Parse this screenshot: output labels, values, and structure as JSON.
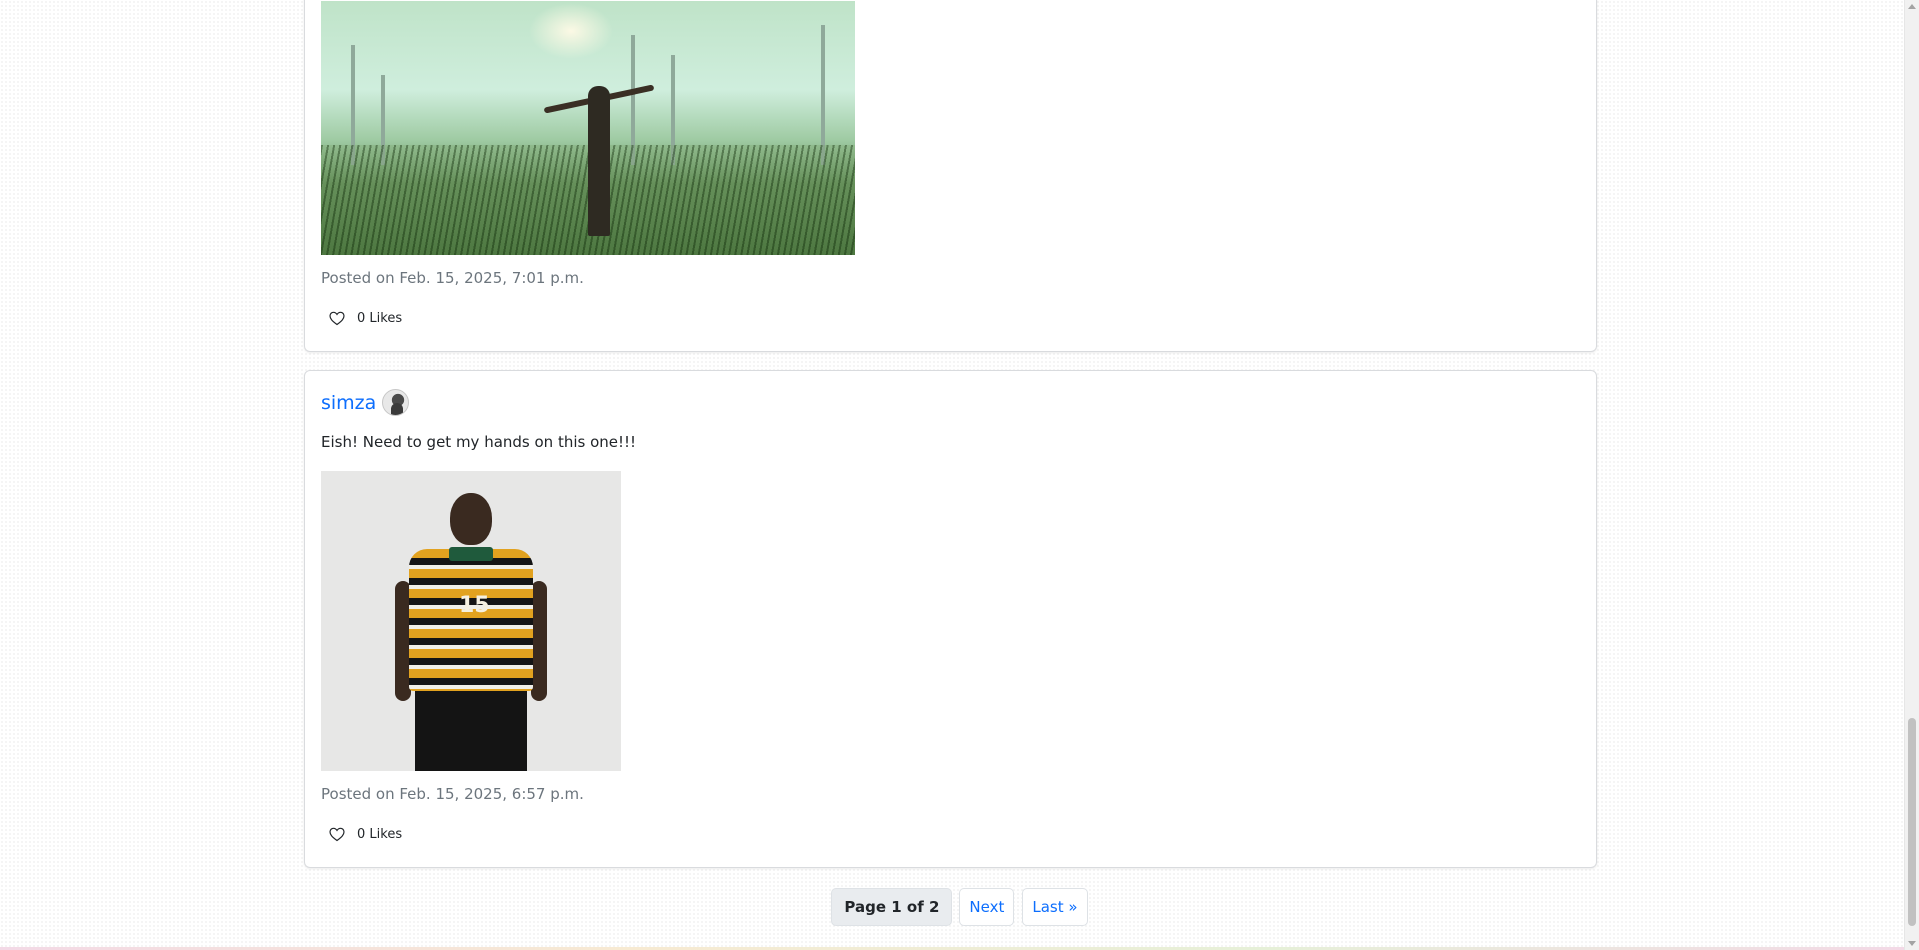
{
  "posts": [
    {
      "author": "",
      "text": "",
      "image_alt": "Man with raised arms standing in a misty green field",
      "posted": "Posted on Feb. 15, 2025, 7:01 p.m.",
      "likes": "0 Likes"
    },
    {
      "author": "simza",
      "text": "Eish! Need to get my hands on this one!!!",
      "image_alt": "Man wearing a striped yellow, black and white polo shirt",
      "posted": "Posted on Feb. 15, 2025, 6:57 p.m.",
      "likes": "0 Likes",
      "shirt_number": "15"
    }
  ],
  "pagination": {
    "current": "Page 1 of 2",
    "next": "Next",
    "last": "Last »"
  },
  "colors": {
    "link": "#0d6efd",
    "muted_text": "#6c757d",
    "card_border": "#d9dbde",
    "page_current_bg": "#e9ecef"
  },
  "icons": {
    "like": "heart-outline-icon",
    "scroll_up": "scroll-up-arrow-icon",
    "scroll_down": "scroll-down-arrow-icon"
  }
}
